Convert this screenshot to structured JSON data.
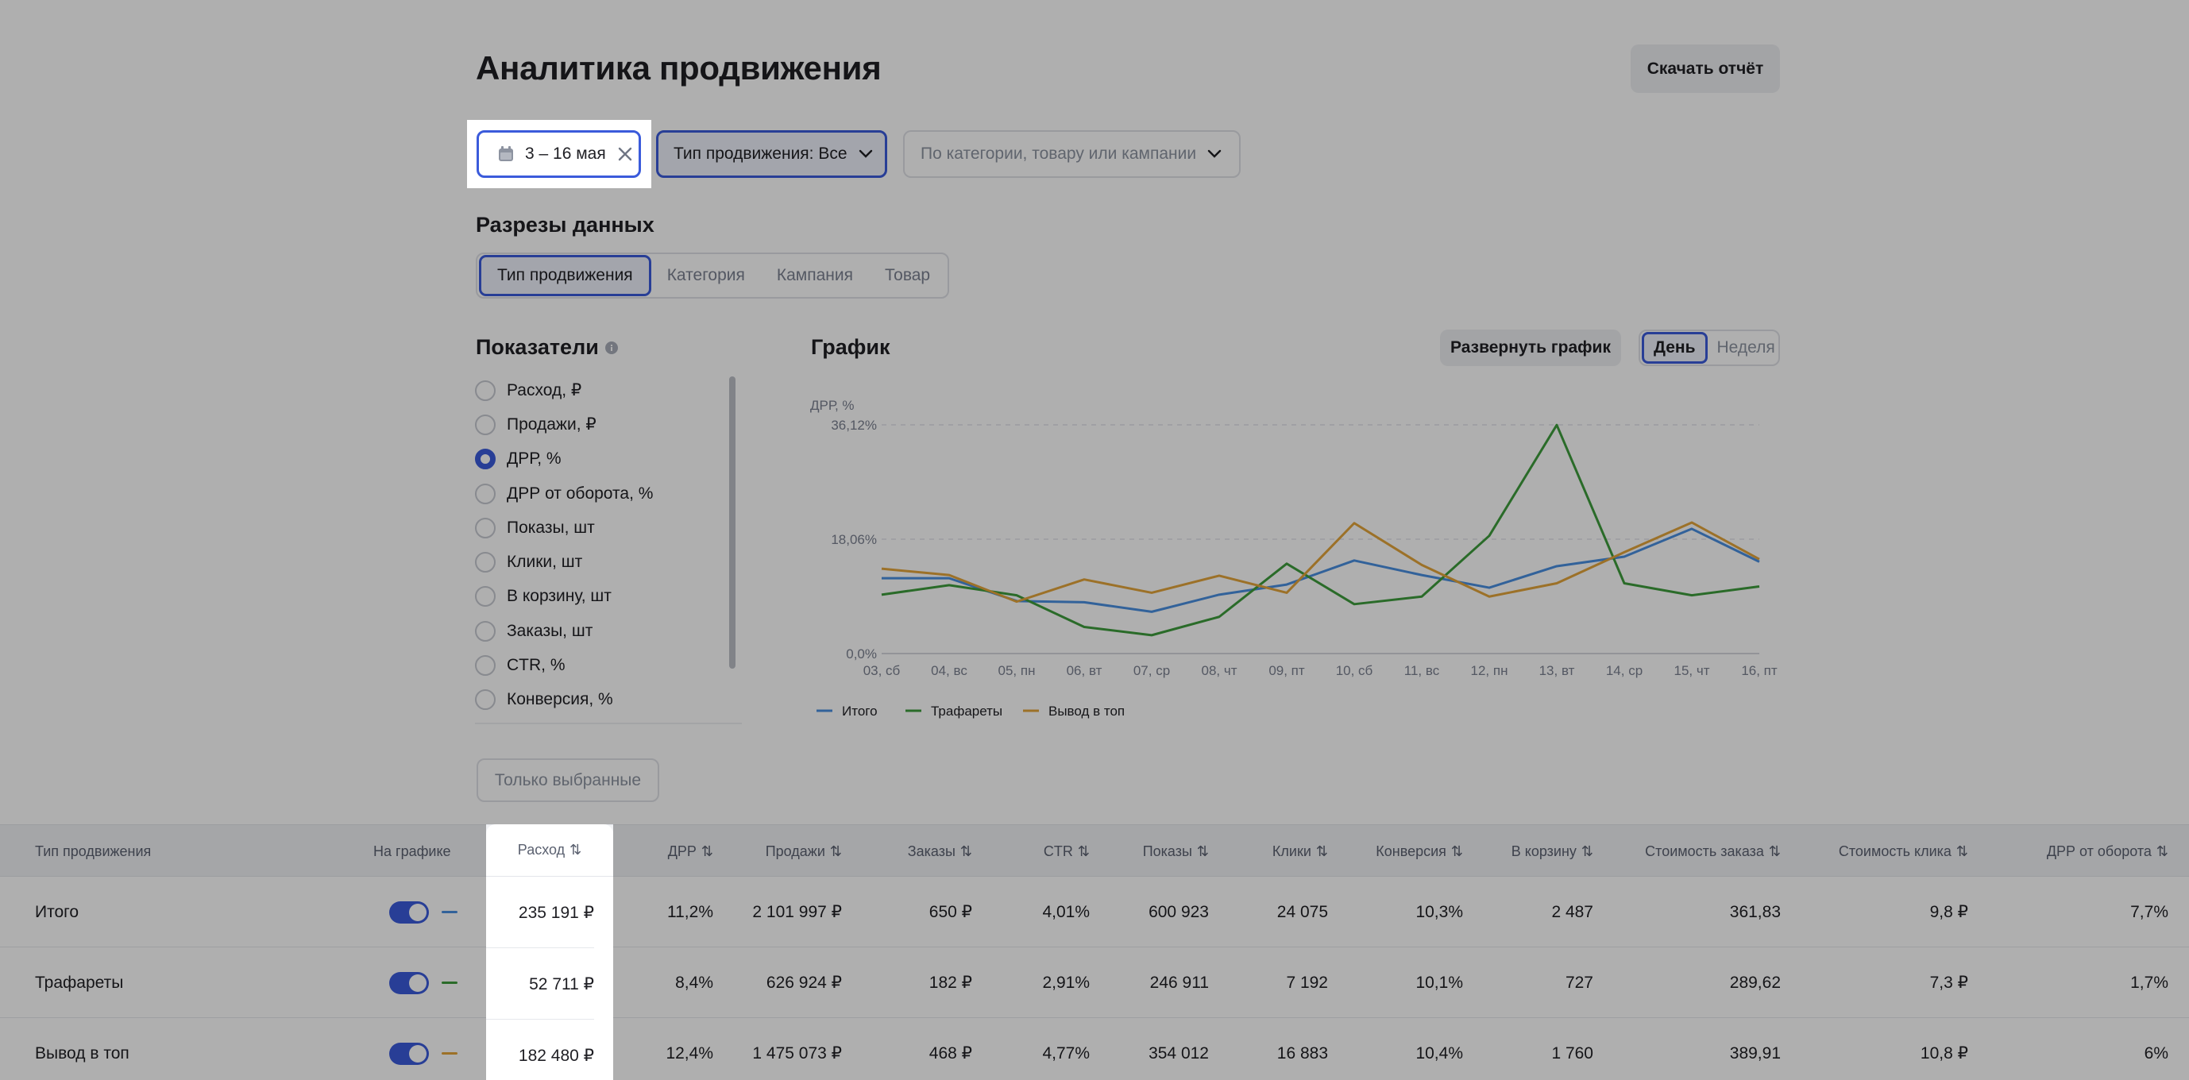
{
  "title": "Аналитика продвижения",
  "download_button": "Скачать отчёт",
  "filters": {
    "date": "3 – 16 мая",
    "promo_type": "Тип продвижения: Все",
    "search_placeholder": "По категории, товару или кампании"
  },
  "slices": {
    "title": "Разрезы данных",
    "tabs": [
      "Тип продвижения",
      "Категория",
      "Кампания",
      "Товар"
    ]
  },
  "metrics": {
    "title": "Показатели",
    "items": [
      "Расход, ₽",
      "Продажи, ₽",
      "ДРР, %",
      "ДРР от оборота, %",
      "Показы, шт",
      "Клики, шт",
      "В корзину, шт",
      "Заказы, шт",
      "CTR, %",
      "Конверсия, %"
    ],
    "selected": "ДРР, %"
  },
  "only_selected_button": "Только выбранные",
  "chart": {
    "title": "График",
    "expand_button": "Развернуть график",
    "period_day": "День",
    "period_week": "Неделя"
  },
  "chart_data": {
    "type": "line",
    "ylabel": "ДРР, %",
    "yticks": [
      "0,0%",
      "18,06%",
      "36,12%"
    ],
    "ylim": [
      0,
      36.12
    ],
    "categories": [
      "03, сб",
      "04, вс",
      "05, пн",
      "06, вт",
      "07, ср",
      "08, чт",
      "09, пт",
      "10, сб",
      "11, вс",
      "12, пн",
      "13, вт",
      "14, ср",
      "15, чт",
      "16, пт"
    ],
    "series": [
      {
        "name": "Итого",
        "color": "#4a8fe0",
        "values": [
          11.9,
          11.9,
          8.3,
          8.1,
          6.6,
          9.3,
          10.9,
          14.7,
          12.4,
          10.4,
          13.8,
          15.3,
          19.7,
          14.5
        ]
      },
      {
        "name": "Трафареты",
        "color": "#3e9d3c",
        "values": [
          9.3,
          10.8,
          9.2,
          4.2,
          2.9,
          5.8,
          14.2,
          7.8,
          9.0,
          18.6,
          36.1,
          11.1,
          9.2,
          10.6
        ]
      },
      {
        "name": "Вывод в топ",
        "color": "#e4a53b",
        "values": [
          13.4,
          12.4,
          8.2,
          11.7,
          9.6,
          12.3,
          9.6,
          20.6,
          14.0,
          9.0,
          11.1,
          16.0,
          20.7,
          14.9
        ]
      }
    ]
  },
  "table": {
    "headers": [
      "Тип продвижения",
      "На графике",
      "Расход",
      "ДРР",
      "Продажи",
      "Заказы",
      "CTR",
      "Показы",
      "Клики",
      "Конверсия",
      "В корзину",
      "Стоимость заказа",
      "Стоимость клика",
      "ДРР от оборота"
    ],
    "sort_icon": "⇅",
    "rows": [
      {
        "name": "Итого",
        "color": "#4a8fe0",
        "cells": [
          "235 191 ₽",
          "11,2%",
          "2 101 997 ₽",
          "650 ₽",
          "4,01%",
          "600 923",
          "24 075",
          "10,3%",
          "2 487",
          "361,83",
          "9,8 ₽",
          "7,7%"
        ]
      },
      {
        "name": "Трафареты",
        "color": "#3e9d3c",
        "cells": [
          "52 711 ₽",
          "8,4%",
          "626 924 ₽",
          "182 ₽",
          "2,91%",
          "246 911",
          "7 192",
          "10,1%",
          "727",
          "289,62",
          "7,3 ₽",
          "1,7%"
        ]
      },
      {
        "name": "Вывод в топ",
        "color": "#e4a53b",
        "cells": [
          "182 480 ₽",
          "12,4%",
          "1 475 073 ₽",
          "468 ₽",
          "4,77%",
          "354 012",
          "16 883",
          "10,4%",
          "1 760",
          "389,91",
          "10,8 ₽",
          "6%"
        ]
      }
    ]
  }
}
